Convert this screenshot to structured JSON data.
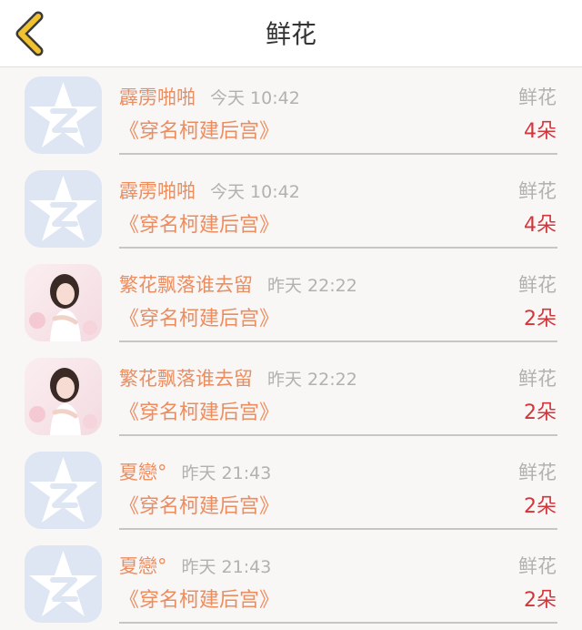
{
  "colors": {
    "accent": "#ec8d5f",
    "count": "#d2363b",
    "muted": "#b3b0b0",
    "back": "#f0c230"
  },
  "header": {
    "title": "鲜花",
    "back_icon": "chevron-left-icon"
  },
  "records": [
    {
      "avatar": "qzone-default-avatar",
      "name": "霹雳啪啪",
      "time": "今天 10:42",
      "gift": "鲜花",
      "book": "《穿名柯建后宫》",
      "count": "4朵"
    },
    {
      "avatar": "qzone-default-avatar",
      "name": "霹雳啪啪",
      "time": "今天 10:42",
      "gift": "鲜花",
      "book": "《穿名柯建后宫》",
      "count": "4朵"
    },
    {
      "avatar": "girl-photo-avatar",
      "name": "繁花飘落谁去留",
      "time": "昨天 22:22",
      "gift": "鲜花",
      "book": "《穿名柯建后宫》",
      "count": "2朵"
    },
    {
      "avatar": "girl-photo-avatar",
      "name": "繁花飘落谁去留",
      "time": "昨天 22:22",
      "gift": "鲜花",
      "book": "《穿名柯建后宫》",
      "count": "2朵"
    },
    {
      "avatar": "qzone-default-avatar",
      "name": "夏戀°",
      "time": "昨天 21:43",
      "gift": "鲜花",
      "book": "《穿名柯建后宫》",
      "count": "2朵"
    },
    {
      "avatar": "qzone-default-avatar",
      "name": "夏戀°",
      "time": "昨天 21:43",
      "gift": "鲜花",
      "book": "《穿名柯建后宫》",
      "count": "2朵"
    }
  ]
}
